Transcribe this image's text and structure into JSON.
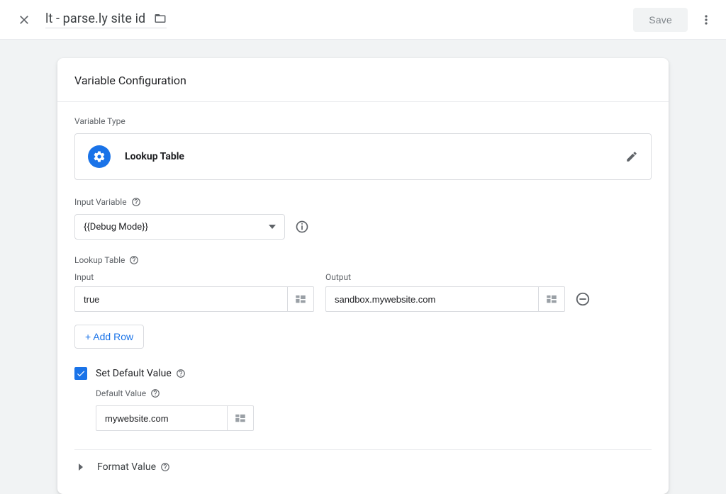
{
  "header": {
    "title": "lt - parse.ly site id",
    "save_label": "Save"
  },
  "card": {
    "title": "Variable Configuration",
    "variable_type_label": "Variable Type",
    "variable_type_value": "Lookup Table",
    "input_variable_label": "Input Variable",
    "input_variable_value": "{{Debug Mode}}",
    "lookup_table_label": "Lookup Table",
    "columns": {
      "input": "Input",
      "output": "Output"
    },
    "rows": [
      {
        "input": "true",
        "output": "sandbox.mywebsite.com"
      }
    ],
    "add_row_label": "+ Add Row",
    "set_default_label": "Set Default Value",
    "default_value_label": "Default Value",
    "default_value": "mywebsite.com",
    "format_value_label": "Format Value"
  }
}
